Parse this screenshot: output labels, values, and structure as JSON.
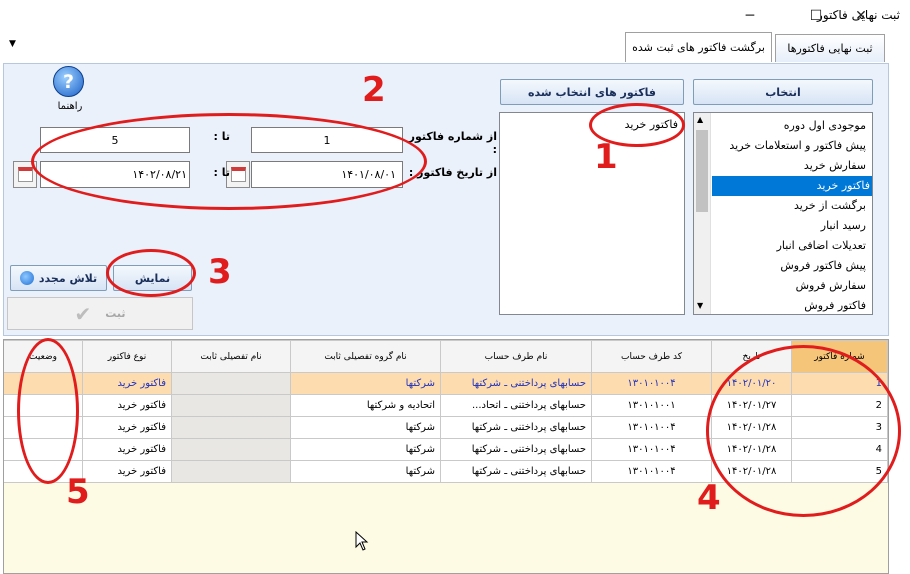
{
  "window": {
    "title": "ثبت نهایی فاکتور",
    "minimize": "─",
    "maximize": "☐",
    "close": "✕"
  },
  "menu": {
    "dropdown_icon": "▼"
  },
  "tabs": [
    {
      "label": "ثبت نهایی فاکتورها"
    },
    {
      "label": "برگشت فاکتور های ثبت شده"
    }
  ],
  "help": {
    "label": "راهنما",
    "icon": "?"
  },
  "selection": {
    "left_header": "فاکتور های انتخاب شده",
    "right_header": "انتخاب",
    "selected_items": [
      "فاکتور خرید"
    ],
    "options": [
      "موجودی اول دوره",
      "پیش فاکتور و استعلامات خرید",
      "سفارش خرید",
      "فاکتور خرید",
      "برگشت از خرید",
      "رسید انبار",
      "تعدیلات اضافی انبار",
      "پیش فاکتور فروش",
      "سفارش فروش",
      "فاکتور فروش"
    ],
    "selected_index": 3
  },
  "filters": {
    "invoice_from_label": "از شماره فاکتور :",
    "invoice_from": "1",
    "to_label": "تا :",
    "invoice_to": "5",
    "date_from_label": "از تاریخ فاکتور :",
    "date_from": "۱۴۰۱/۰۸/۰۱",
    "date_to_label": "تا :",
    "date_to": "۱۴۰۲/۰۸/۲۱"
  },
  "buttons": {
    "show": "نمایش",
    "retry": "تلاش مجدد",
    "submit": "ثبت",
    "check_icon": "✔"
  },
  "table": {
    "columns": [
      "شماره فاکتور",
      "تاریخ",
      "کد طرف حساب",
      "نام طرف حساب",
      "نام گروه تفصیلی ثابت",
      "نام تفصیلی ثابت",
      "نوع فاکتور",
      "وضعیت"
    ],
    "rows": [
      [
        "1",
        "۱۴۰۲/۰۱/۲۰",
        "۱۳۰۱۰۱۰۰۴",
        "حسابهای پرداختنی ـ شرکتها",
        "شرکتها",
        "",
        "فاکتور خرید",
        ""
      ],
      [
        "2",
        "۱۴۰۲/۰۱/۲۷",
        "۱۳۰۱۰۱۰۰۱",
        "حسابهای پرداختنی ـ اتحاد...",
        "اتحادیه و شرکتها",
        "",
        "فاکتور خرید",
        ""
      ],
      [
        "3",
        "۱۴۰۲/۰۱/۲۸",
        "۱۳۰۱۰۱۰۰۴",
        "حسابهای پرداختنی ـ شرکتها",
        "شرکتها",
        "",
        "فاکتور خرید",
        ""
      ],
      [
        "4",
        "۱۴۰۲/۰۱/۲۸",
        "۱۳۰۱۰۱۰۰۴",
        "حسابهای پرداختنی ـ شرکتها",
        "شرکتها",
        "",
        "فاکتور خرید",
        ""
      ],
      [
        "5",
        "۱۴۰۲/۰۱/۲۸",
        "۱۳۰۱۰۱۰۰۴",
        "حسابهای پرداختنی ـ شرکتها",
        "شرکتها",
        "",
        "فاکتور خرید",
        ""
      ]
    ]
  },
  "annotations": [
    "1",
    "2",
    "3",
    "4",
    "5"
  ],
  "colors": {
    "annotation": "#e01c1c",
    "selection": "#0078d7",
    "row_highlight": "#fddcb0",
    "sorted_header": "#f5c57a"
  }
}
